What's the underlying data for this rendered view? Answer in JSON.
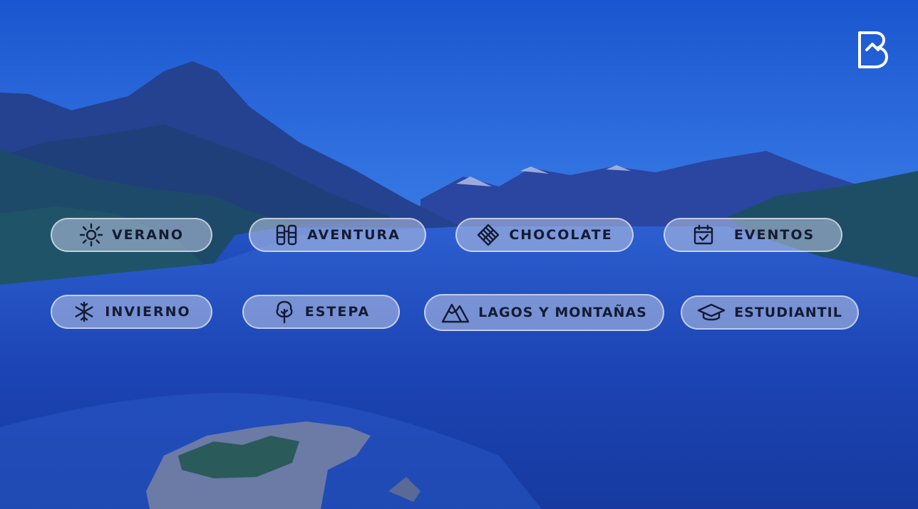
{
  "brand": {
    "logo_icon": "brand-b-logo-icon"
  },
  "categories": [
    {
      "id": "verano",
      "label": "VERANO",
      "icon": "sun-icon"
    },
    {
      "id": "aventura",
      "label": "AVENTURA",
      "icon": "binoculars-icon"
    },
    {
      "id": "chocolate",
      "label": "CHOCOLATE",
      "icon": "chocolate-icon"
    },
    {
      "id": "eventos",
      "label": "EVENTOS",
      "icon": "calendar-check-icon"
    },
    {
      "id": "invierno",
      "label": "INVIERNO",
      "icon": "snowflake-icon"
    },
    {
      "id": "estepa",
      "label": "ESTEPA",
      "icon": "tree-icon"
    },
    {
      "id": "lagos",
      "label": "LAGOS Y MONTAÑAS",
      "icon": "mountains-icon"
    },
    {
      "id": "estudiantil",
      "label": "ESTUDIANTIL",
      "icon": "graduation-cap-icon"
    }
  ],
  "colors": {
    "overlay_blue": "#1f5fd6",
    "pill_bg": "#becbe6",
    "text_dark": "#141b33"
  }
}
